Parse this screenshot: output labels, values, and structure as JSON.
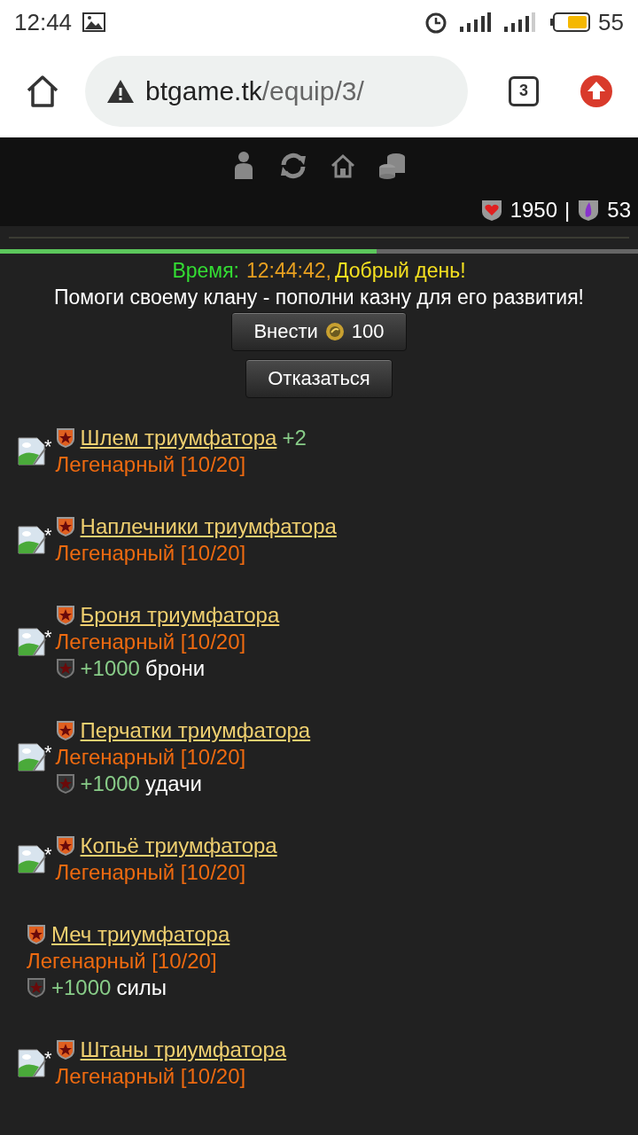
{
  "status_bar": {
    "time": "12:44",
    "battery": "55"
  },
  "browser": {
    "url_host": "btgame.tk",
    "url_path": "/equip/3/",
    "tab_count": "3"
  },
  "resources": [
    {
      "kind": "health",
      "value": "1950"
    },
    {
      "kind": "mana",
      "value": "53"
    }
  ],
  "resource_separator": "|",
  "progress": {
    "level": 0.59
  },
  "greeting": {
    "label": "Время:",
    "time": "12:44:42,",
    "message": "Добрый день!"
  },
  "clan_message": "Помоги своему клану - пополни казну для его развития!",
  "buttons": [
    {
      "kind": "deposit",
      "label": "Внести",
      "amount": "100"
    },
    {
      "kind": "plain",
      "label": "Отказаться"
    }
  ],
  "items": [
    {
      "has_image": true,
      "mark": "*",
      "name": "Шлем триумфатора",
      "bonus": "+2",
      "rarity": "Легенарный [10/20]"
    },
    {
      "has_image": true,
      "mark": "*",
      "name": "Наплечники триумфатора",
      "rarity": "Легенарный [10/20]"
    },
    {
      "has_image": true,
      "mark": "*",
      "name": "Броня триумфатора",
      "rarity": "Легенарный [10/20]",
      "stat": {
        "value": "+1000",
        "label": "брони"
      }
    },
    {
      "has_image": true,
      "mark": "*",
      "name": "Перчатки триумфатора",
      "rarity": "Легенарный [10/20]",
      "stat": {
        "value": "+1000",
        "label": "удачи"
      }
    },
    {
      "has_image": true,
      "mark": "*",
      "name": "Копьё триумфатора",
      "rarity": "Легенарный [10/20]"
    },
    {
      "has_image": false,
      "name": "Меч триумфатора",
      "rarity": "Легенарный [10/20]",
      "stat": {
        "value": "+1000",
        "label": "силы"
      }
    },
    {
      "has_image": true,
      "mark": "*",
      "name": "Штаны триумфатора",
      "rarity": "Легенарный [10/20]"
    }
  ]
}
